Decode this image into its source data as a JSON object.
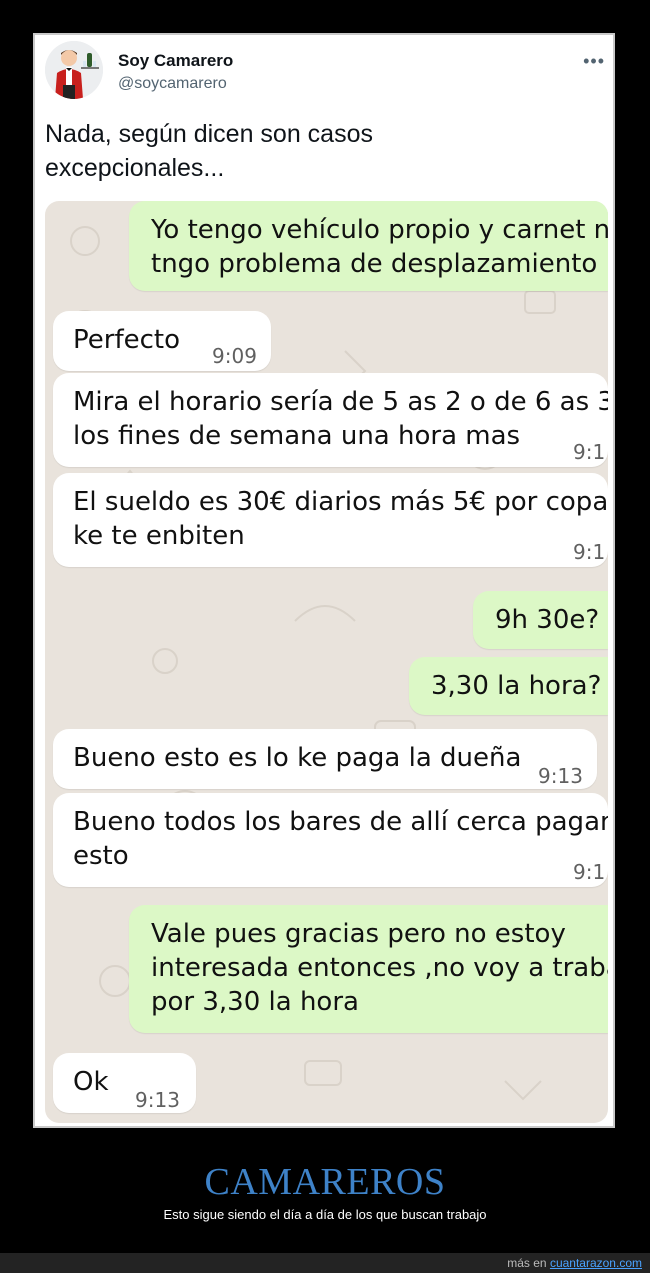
{
  "tweet": {
    "author_name": "Soy Camarero",
    "author_handle": "@soycamarero",
    "more_icon": "more-horizontal-icon",
    "text_line1": "Nada, según dicen son casos",
    "text_line2": "excepcionales..."
  },
  "chat": {
    "messages": [
      {
        "dir": "out",
        "lines": [
          "Yo tengo vehículo propio y carnet n",
          "tngo problema de desplazamiento"
        ],
        "time": ""
      },
      {
        "dir": "in",
        "lines": [
          "Perfecto"
        ],
        "time": "9:09"
      },
      {
        "dir": "in",
        "lines": [
          "Mira el horario sería de 5 as 2 o de 6 as 3",
          "los fines de semana una hora mas"
        ],
        "time": "9:1"
      },
      {
        "dir": "in",
        "lines": [
          "El sueldo es 30€ diarios más 5€ por copa",
          "ke te enbiten"
        ],
        "time": "9:1"
      },
      {
        "dir": "out",
        "lines": [
          "9h 30e?"
        ],
        "time": ""
      },
      {
        "dir": "out",
        "lines": [
          "3,30 la hora?"
        ],
        "time": ""
      },
      {
        "dir": "in",
        "lines": [
          "Bueno esto es lo ke paga la dueña"
        ],
        "time": "9:13"
      },
      {
        "dir": "in",
        "lines": [
          "Bueno todos los bares de allí cerca pagan",
          "esto"
        ],
        "time": "9:1"
      },
      {
        "dir": "out",
        "lines": [
          "Vale pues gracias pero no estoy",
          "interesada entonces ,no voy a traba",
          "por 3,30 la hora"
        ],
        "time": ""
      },
      {
        "dir": "in",
        "lines": [
          "Ok"
        ],
        "time": "9:13"
      }
    ]
  },
  "caption": {
    "title": "CAMAREROS",
    "subtitle": "Esto sigue siendo el día a día de los que buscan trabajo"
  },
  "footer": {
    "prefix": "más en",
    "link": "cuantarazon.com"
  },
  "colors": {
    "accent": "#3e82c8",
    "bubble_out": "#dcf8c6",
    "bubble_in": "#ffffff",
    "chat_bg": "#e9e3dc"
  }
}
